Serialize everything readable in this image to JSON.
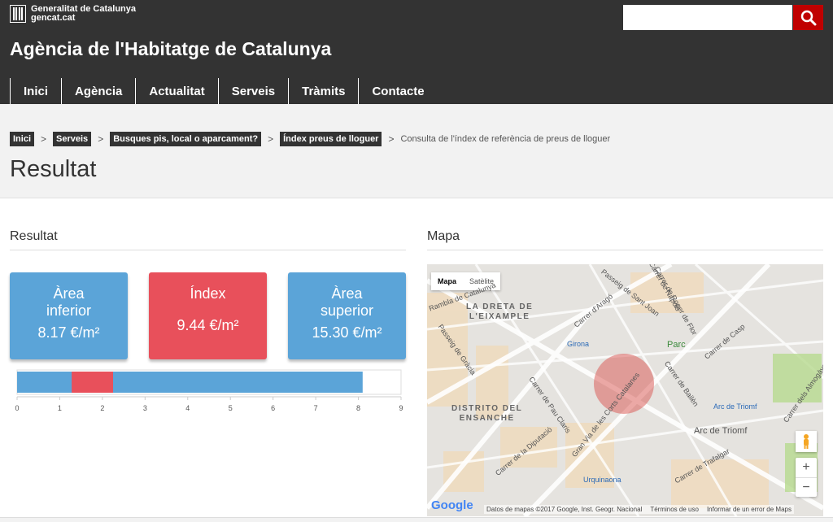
{
  "header": {
    "logo_line1": "Generalitat de Catalunya",
    "logo_line2": "gencat.cat",
    "search_placeholder": "",
    "title": "Agència de l'Habitatge de Catalunya",
    "nav": [
      "Inici",
      "Agència",
      "Actualitat",
      "Serveis",
      "Tràmits",
      "Contacte"
    ],
    "colors": {
      "header_bg": "#333333",
      "search_button": "#c00000"
    }
  },
  "breadcrumb": {
    "links": [
      "Inici",
      "Serveis",
      "Busques pis, local o aparcament?",
      "Índex preus de lloguer"
    ],
    "separator": ">",
    "current": "Consulta de l'índex de referència de preus de lloguer"
  },
  "page_title": "Resultat",
  "result": {
    "section_title": "Resultat",
    "boxes": [
      {
        "label_line1": "Àrea",
        "label_line2": "inferior",
        "value": "8.17 €/m²",
        "color": "#5ba4d8"
      },
      {
        "label_line1": "Índex",
        "label_line2": "",
        "value": "9.44 €/m²",
        "color": "#e8505b"
      },
      {
        "label_line1": "Àrea",
        "label_line2": "superior",
        "value": "15.30 €/m²",
        "color": "#5ba4d8"
      }
    ]
  },
  "chart_data": {
    "type": "bar",
    "orientation": "horizontal",
    "series": [
      {
        "start": 0,
        "end": 8.1,
        "color": "#5ba4d8"
      },
      {
        "start": 1.28,
        "end": 2.25,
        "color": "#e8505b"
      }
    ],
    "xlim": [
      0,
      9
    ],
    "ticks": [
      0,
      1,
      2,
      3,
      4,
      5,
      6,
      7,
      8,
      9
    ]
  },
  "map": {
    "section_title": "Mapa",
    "type_options": [
      "Mapa",
      "Satèlite"
    ],
    "districts": [
      {
        "line1": "LA DRETA DE",
        "line2": "L'EIXAMPLE"
      },
      {
        "line1": "DISTRITO DEL",
        "line2": "ENSANCHE"
      }
    ],
    "streets": [
      "Carrer de Nàpols",
      "Carrer de Roger de Flor",
      "Carrer d'Aragó",
      "Passeig de Sant Joan",
      "Carrer de Casp",
      "Passeig de Gràcia",
      "Carrer de Pau Claris",
      "Carrer de Bailèn",
      "Gran Via de les Corts Catalanes",
      "Carrer de la Diputació",
      "Carrer de Trafalgar",
      "Carrer dels Almogàvers",
      "Rambla de Catalunya"
    ],
    "metro": [
      "Girona",
      "Arc de Triomf",
      "Urquinaona"
    ],
    "places": [
      "Parc",
      "Arc de Triomf"
    ],
    "zoom_in": "+",
    "zoom_out": "−",
    "google": "Google",
    "attribution": [
      "Datos de mapas ©2017 Google, Inst. Geogr. Nacional",
      "Términos de uso",
      "Informar de un error de Maps"
    ],
    "highlight_color": "#d9534f"
  }
}
